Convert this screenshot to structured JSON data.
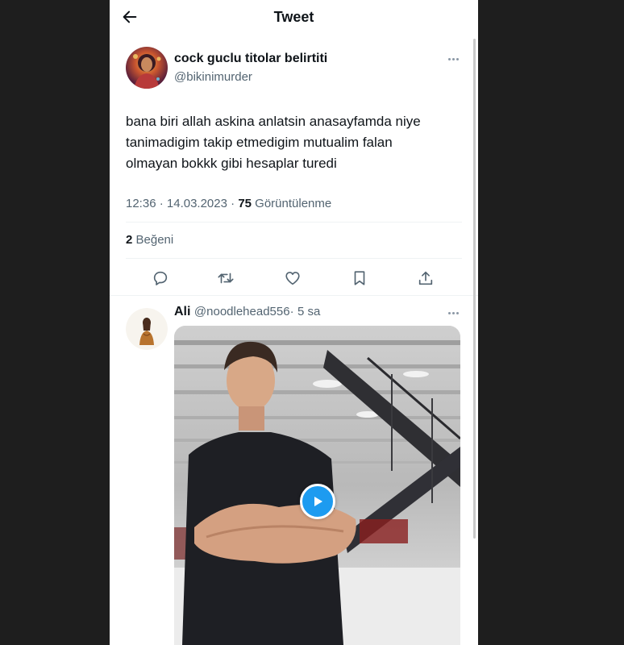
{
  "header": {
    "title": "Tweet",
    "back_icon": "arrow-left-icon"
  },
  "tweet": {
    "author_name": "cock guclu titolar belirtiti",
    "author_handle": "@bikinimurder",
    "text_lines": [
      "bana biri allah askina anlatsin anasayfamda niye",
      "tanimadigim takip etmedigim mutualim falan",
      "olmayan bokkk gibi hesaplar turedi"
    ],
    "time": "12:36",
    "date": "14.03.2023",
    "views_count": "75",
    "views_label": "Görüntülenme",
    "separator": "·",
    "likes_count": "2",
    "likes_label": "Beğeni"
  },
  "actions": [
    {
      "name": "reply",
      "icon": "comment-icon"
    },
    {
      "name": "retweet",
      "icon": "retweet-icon"
    },
    {
      "name": "like",
      "icon": "heart-icon"
    },
    {
      "name": "bookmark",
      "icon": "bookmark-icon"
    },
    {
      "name": "share",
      "icon": "share-icon"
    }
  ],
  "reply": {
    "name": "Ali",
    "handle": "@noodlehead556",
    "separator": "·",
    "time": "5 sa",
    "media_type": "video"
  },
  "colors": {
    "text_primary": "#0f1419",
    "text_secondary": "#536471",
    "accent": "#1d9bf0",
    "divider": "#eff3f4"
  }
}
